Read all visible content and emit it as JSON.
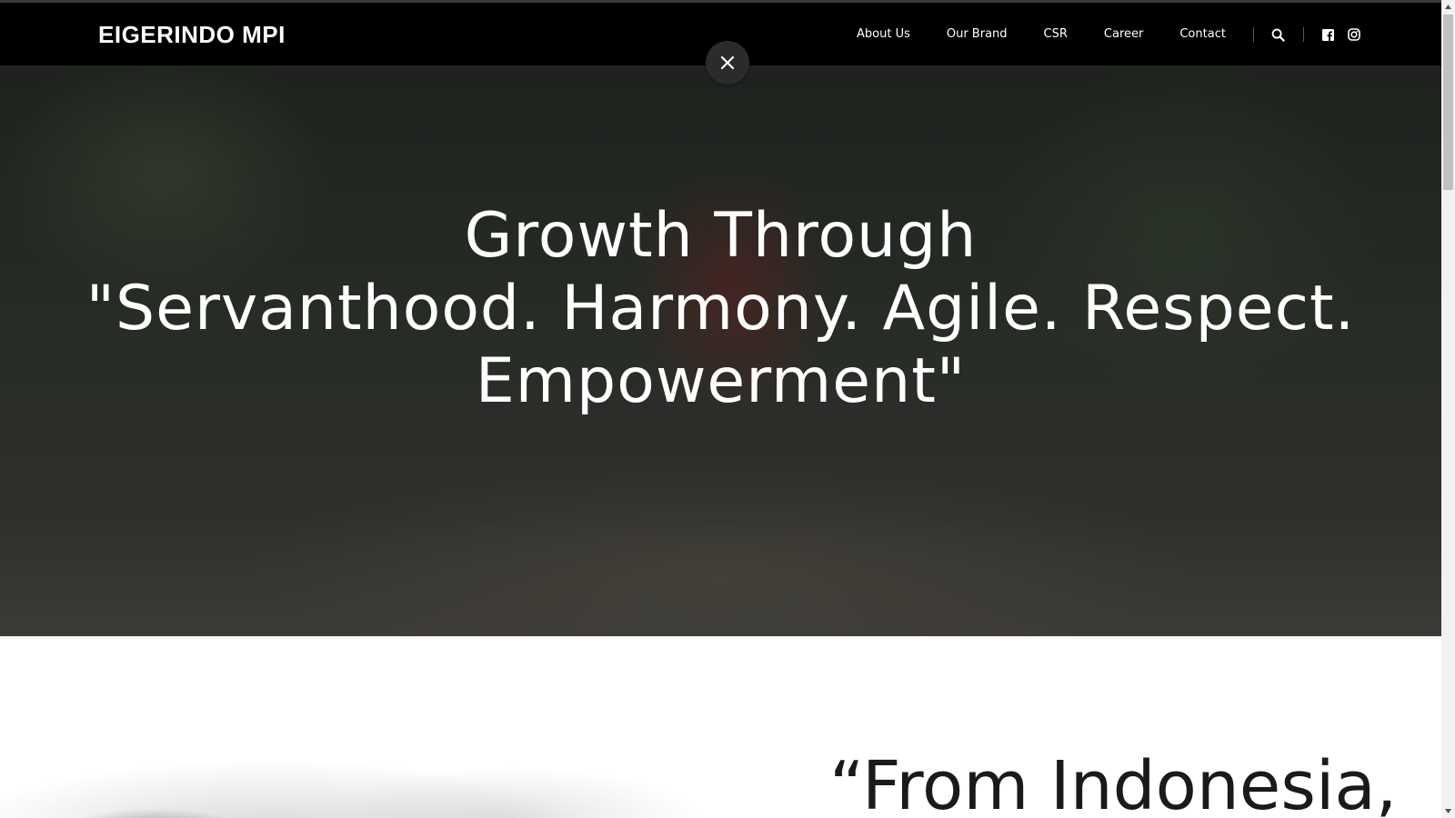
{
  "header": {
    "logo": "EIGERINDO MPI",
    "nav": [
      {
        "label": "About Us"
      },
      {
        "label": "Our Brand"
      },
      {
        "label": "CSR"
      },
      {
        "label": "Career"
      },
      {
        "label": "Contact"
      }
    ],
    "icons": {
      "search": "search-icon",
      "facebook": "facebook-icon",
      "instagram": "instagram-icon"
    }
  },
  "overlay": {
    "close_icon": "close-icon"
  },
  "hero": {
    "title_lines": [
      "Growth Through",
      "\"Servanthood. Harmony. Agile. Respect.",
      "Empowerment\""
    ]
  },
  "section2": {
    "quote": "“From Indonesia,"
  },
  "colors": {
    "header_bg": "#000000",
    "hero_text": "#ffffff",
    "close_button_bg": "#2b2b2b",
    "quote_text": "#1a1a1a"
  }
}
